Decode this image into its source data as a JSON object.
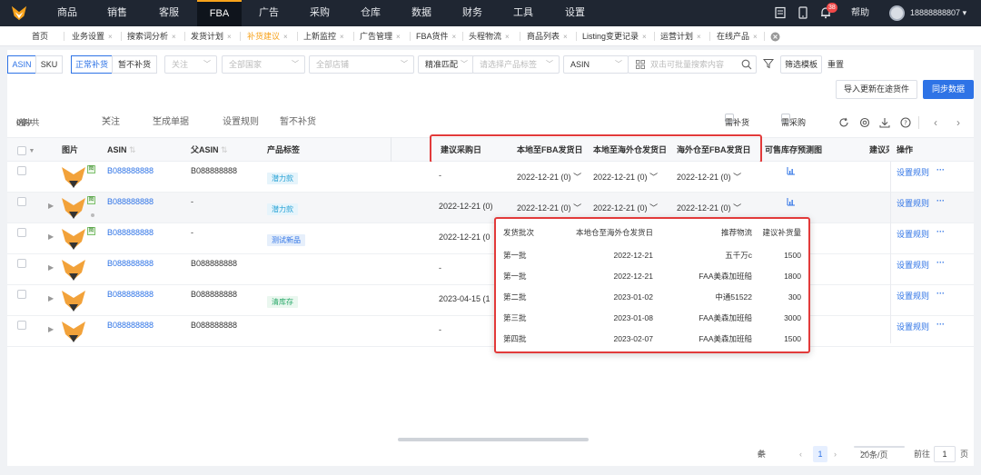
{
  "topnav": {
    "menu": [
      "商品",
      "销售",
      "客服",
      "FBA",
      "广告",
      "采购",
      "仓库",
      "数据",
      "财务",
      "工具",
      "设置"
    ],
    "active": "FBA",
    "notification_count": "38",
    "help": "帮助",
    "username": "18888888807"
  },
  "tabs": [
    {
      "label": "首页"
    },
    {
      "label": "业务设置"
    },
    {
      "label": "搜索词分析"
    },
    {
      "label": "发货计划"
    },
    {
      "label": "补货建议"
    },
    {
      "label": "上新监控"
    },
    {
      "label": "广告管理"
    },
    {
      "label": "FBA货件"
    },
    {
      "label": "头程物流"
    },
    {
      "label": "商品列表"
    },
    {
      "label": "Listing变更记录"
    },
    {
      "label": "运营计划"
    },
    {
      "label": "在线产品"
    }
  ],
  "filters": {
    "asin": "ASIN",
    "sku": "SKU",
    "normal": "正常补货",
    "pause": "暂不补货",
    "follow": "关注",
    "country": "全部国家",
    "shop": "全部店铺",
    "match": "精准匹配",
    "tag_placeholder": "请选择产品标签",
    "search_type": "ASIN",
    "search_placeholder": "双击可批量搜索内容",
    "filter_template": "筛选模板",
    "reset": "重置"
  },
  "actions": {
    "import": "导入更新在途货件",
    "sync": "同步数据"
  },
  "toolbar": {
    "selected": "选中",
    "selected_count": "0",
    "selected_unit": "条/共",
    "total": "6",
    "total_unit": "条",
    "follow": "关注",
    "gen_doc": "生成单据",
    "set_rule": "设置规则",
    "pause": "暂不补货",
    "need_restock": "需补货",
    "need_purchase": "需采购"
  },
  "columns": {
    "image": "图片",
    "asin": "ASIN",
    "parent_asin": "父ASIN",
    "tag": "产品标签",
    "purchase_date": "建议采购日",
    "local_fba": "本地至FBA发货日",
    "local_overseas": "本地至海外仓发货日",
    "overseas_fba": "海外仓至FBA发货日",
    "forecast": "可售库存预测图",
    "suggest": "建议采",
    "ops": "操作"
  },
  "rows": [
    {
      "asin": "B088888888",
      "parent": "B088888888",
      "tag": "潜力款",
      "tag_style": "cyan",
      "purchase": "-",
      "local_fba": "2022-12-21 (0)",
      "local_overseas": "2022-12-21 (0)",
      "overseas_fba": "2022-12-21 (0)",
      "rule": "设置规则",
      "more": "···"
    },
    {
      "asin": "B088888888",
      "parent": "-",
      "tag": "潜力款",
      "tag_style": "cyan",
      "purchase": "2022-12-21 (0)",
      "local_fba": "2022-12-21 (0)",
      "local_overseas": "2022-12-21 (0)",
      "overseas_fba": "2022-12-21 (0)",
      "rule": "设置规则",
      "more": "···"
    },
    {
      "asin": "B088888888",
      "parent": "-",
      "tag": "测试新品",
      "tag_style": "blue",
      "purchase": "2022-12-21 (0",
      "local_fba": "",
      "local_overseas": "",
      "overseas_fba": "",
      "rule": "设置规则",
      "more": "···"
    },
    {
      "asin": "B088888888",
      "parent": "B088888888",
      "tag": "",
      "tag_style": "",
      "purchase": "-",
      "local_fba": "",
      "local_overseas": "",
      "overseas_fba": "",
      "rule": "设置规则",
      "more": "···"
    },
    {
      "asin": "B088888888",
      "parent": "B088888888",
      "tag": "清库存",
      "tag_style": "green",
      "purchase": "2023-04-15 (1",
      "local_fba": "",
      "local_overseas": "",
      "overseas_fba": "",
      "rule": "设置规则",
      "more": "···"
    },
    {
      "asin": "B088888888",
      "parent": "B088888888",
      "tag": "",
      "tag_style": "",
      "purchase": "-",
      "local_fba": "",
      "local_overseas": "",
      "overseas_fba": "",
      "rule": "设置规则",
      "more": "···"
    }
  ],
  "popup": {
    "headers": {
      "batch": "发货批次",
      "date": "本地仓至海外仓发货日",
      "logistics": "推荐物流",
      "qty": "建议补货量"
    },
    "items": [
      {
        "batch": "第一批",
        "date": "2022-12-21",
        "logistics": "五千万c",
        "qty": "1500"
      },
      {
        "batch": "第一批",
        "date": "2022-12-21",
        "logistics": "FAA美森加班船",
        "qty": "1800"
      },
      {
        "batch": "第二批",
        "date": "2023-01-02",
        "logistics": "中通51522",
        "qty": "300"
      },
      {
        "batch": "第三批",
        "date": "2023-01-08",
        "logistics": "FAA美森加班船",
        "qty": "3000"
      },
      {
        "batch": "第四批",
        "date": "2023-02-07",
        "logistics": "FAA美森加班船",
        "qty": "1500"
      }
    ]
  },
  "pagination": {
    "total_prefix": "共",
    "total": "6",
    "total_suffix": "条",
    "page": "1",
    "page_size": "20条/页",
    "goto": "前往",
    "goto_page": "1",
    "page_unit": "页"
  }
}
